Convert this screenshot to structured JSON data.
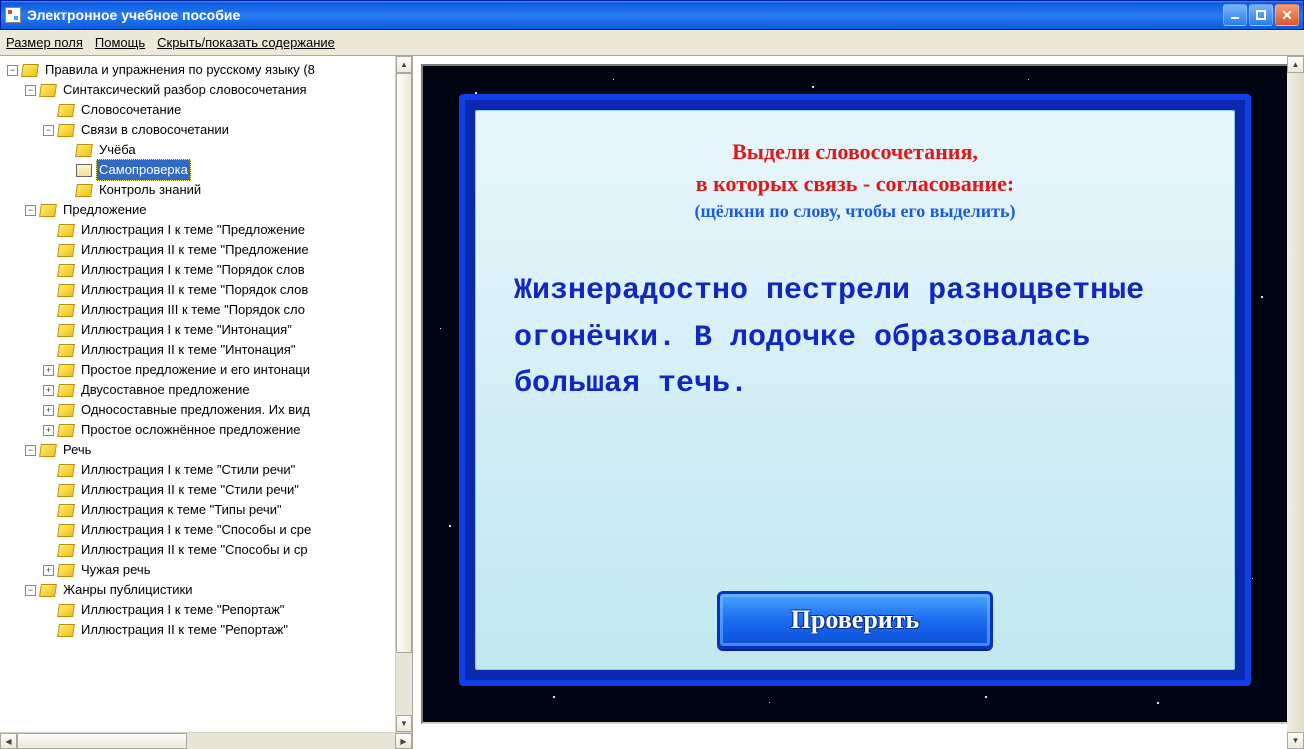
{
  "window": {
    "title": "Электронное учебное пособие"
  },
  "menu": {
    "field_size": "Размер поля",
    "help": "Помощь",
    "toggle_toc": "Скрыть/показать содержание"
  },
  "tree": {
    "items": [
      {
        "level": 0,
        "exp": "-",
        "icon": "closed",
        "label": "Правила и упражнения по русскому языку (8",
        "sel": false
      },
      {
        "level": 1,
        "exp": "-",
        "icon": "closed",
        "label": "Синтаксический разбор словосочетания",
        "sel": false
      },
      {
        "level": 2,
        "exp": "",
        "icon": "closed",
        "label": "Словосочетание",
        "sel": false
      },
      {
        "level": 2,
        "exp": "-",
        "icon": "closed",
        "label": "Связи в словосочетании",
        "sel": false
      },
      {
        "level": 3,
        "exp": "",
        "icon": "closed",
        "label": "Учёба",
        "sel": false
      },
      {
        "level": 3,
        "exp": "",
        "icon": "open",
        "label": "Самопроверка",
        "sel": true
      },
      {
        "level": 3,
        "exp": "",
        "icon": "closed",
        "label": "Контроль знаний",
        "sel": false
      },
      {
        "level": 1,
        "exp": "-",
        "icon": "closed",
        "label": "Предложение",
        "sel": false
      },
      {
        "level": 2,
        "exp": "",
        "icon": "closed",
        "label": "Иллюстрация I к теме \"Предложение",
        "sel": false
      },
      {
        "level": 2,
        "exp": "",
        "icon": "closed",
        "label": "Иллюстрация II к теме \"Предложение",
        "sel": false
      },
      {
        "level": 2,
        "exp": "",
        "icon": "closed",
        "label": "Иллюстрация I к теме \"Порядок слов",
        "sel": false
      },
      {
        "level": 2,
        "exp": "",
        "icon": "closed",
        "label": "Иллюстрация II к теме \"Порядок слов",
        "sel": false
      },
      {
        "level": 2,
        "exp": "",
        "icon": "closed",
        "label": "Иллюстрация III к теме \"Порядок сло",
        "sel": false
      },
      {
        "level": 2,
        "exp": "",
        "icon": "closed",
        "label": "Иллюстрация I к теме \"Интонация\"",
        "sel": false
      },
      {
        "level": 2,
        "exp": "",
        "icon": "closed",
        "label": "Иллюстрация II к теме \"Интонация\"",
        "sel": false
      },
      {
        "level": 2,
        "exp": "+",
        "icon": "closed",
        "label": "Простое предложение и его интонаци",
        "sel": false
      },
      {
        "level": 2,
        "exp": "+",
        "icon": "closed",
        "label": "Двусоставное предложение",
        "sel": false
      },
      {
        "level": 2,
        "exp": "+",
        "icon": "closed",
        "label": "Односоставные предложения. Их вид",
        "sel": false
      },
      {
        "level": 2,
        "exp": "+",
        "icon": "closed",
        "label": "Простое осложнённое предложение",
        "sel": false
      },
      {
        "level": 1,
        "exp": "-",
        "icon": "closed",
        "label": "Речь",
        "sel": false
      },
      {
        "level": 2,
        "exp": "",
        "icon": "closed",
        "label": "Иллюстрация I к теме \"Стили речи\"",
        "sel": false
      },
      {
        "level": 2,
        "exp": "",
        "icon": "closed",
        "label": "Иллюстрация II к теме \"Стили речи\"",
        "sel": false
      },
      {
        "level": 2,
        "exp": "",
        "icon": "closed",
        "label": "Иллюстрация к теме \"Типы речи\"",
        "sel": false
      },
      {
        "level": 2,
        "exp": "",
        "icon": "closed",
        "label": "Иллюстрация I к теме \"Способы и сре",
        "sel": false
      },
      {
        "level": 2,
        "exp": "",
        "icon": "closed",
        "label": "Иллюстрация II к теме \"Способы и ср",
        "sel": false
      },
      {
        "level": 2,
        "exp": "+",
        "icon": "closed",
        "label": "Чужая речь",
        "sel": false
      },
      {
        "level": 1,
        "exp": "-",
        "icon": "closed",
        "label": "Жанры публицистики",
        "sel": false
      },
      {
        "level": 2,
        "exp": "",
        "icon": "closed",
        "label": "Иллюстрация I к теме \"Репортаж\"",
        "sel": false
      },
      {
        "level": 2,
        "exp": "",
        "icon": "closed",
        "label": "Иллюстрация II к теме \"Репортаж\"",
        "sel": false
      }
    ]
  },
  "exercise": {
    "heading1": "Выдели словосочетания,",
    "heading2": "в которых связь - согласование:",
    "hint": "(щёлкни по слову, чтобы его выделить)",
    "sentence": "Жизнерадостно пестрели разноцветные огонёчки. В лодочке образовалась большая течь.",
    "check_label": "Проверить"
  }
}
